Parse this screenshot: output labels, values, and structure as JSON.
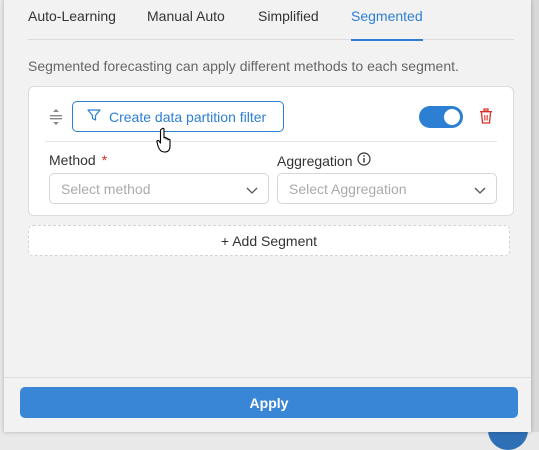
{
  "tabs": [
    {
      "label": "Auto-Learning"
    },
    {
      "label": "Manual Auto"
    },
    {
      "label": "Simplified"
    },
    {
      "label": "Segmented"
    }
  ],
  "active_tab": "Segmented",
  "description": "Segmented forecasting can apply different methods to each segment.",
  "segment": {
    "filter_button": "Create data partition filter",
    "toggle_on": true,
    "method": {
      "label": "Method",
      "required_mark": "*",
      "placeholder": "Select method"
    },
    "aggregation": {
      "label": "Aggregation",
      "placeholder": "Select Aggregation"
    }
  },
  "add_segment_label": "+ Add Segment",
  "apply_label": "Apply",
  "colors": {
    "accent": "#2d7fd3",
    "danger": "#d93025"
  },
  "icons": [
    "drag-handle-icon",
    "filter-icon",
    "toggle-switch",
    "trash-icon",
    "info-icon",
    "chevron-down-icon",
    "hand-cursor-icon"
  ]
}
